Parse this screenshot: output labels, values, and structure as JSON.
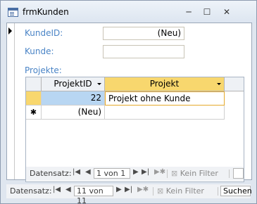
{
  "window": {
    "title": "frmKunden"
  },
  "form": {
    "kundeid_label": "KundeID:",
    "kundeid_value": "(Neu)",
    "kunde_label": "Kunde:",
    "kunde_value": "",
    "projekte_label": "Projekte:"
  },
  "subform": {
    "columns": [
      "ProjektID",
      "Projekt"
    ],
    "rows": [
      {
        "projektid": "22",
        "projekt": "Projekt ohne Kunde"
      }
    ],
    "new_row_marker": "(Neu)",
    "new_row_symbol": "✱",
    "nav": {
      "label": "Datensatz:",
      "record": "1 von 1",
      "filter": "Kein Filter"
    }
  },
  "main_nav": {
    "label": "Datensatz:",
    "record": "11 von 11",
    "filter": "Kein Filter",
    "search": "Suchen"
  }
}
